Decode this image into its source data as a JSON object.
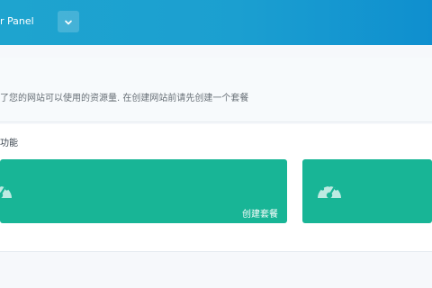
{
  "header": {
    "title": "r Panel",
    "dropdown_icon": "chevron-down-icon"
  },
  "intro": {
    "text": "了您的网站可以使用的资源量. 在创建网站前请先创建一个套餐"
  },
  "features": {
    "title": "功能",
    "cards": [
      {
        "label": "创建套餐",
        "icon": "speedometer-icon"
      },
      {
        "label": "",
        "icon": "speedometer-icon"
      }
    ]
  },
  "colors": {
    "header_gradient_start": "#1ea4cf",
    "header_gradient_end": "#0f8fcf",
    "card": "#18b596",
    "page_background": "#f6f8fb"
  }
}
